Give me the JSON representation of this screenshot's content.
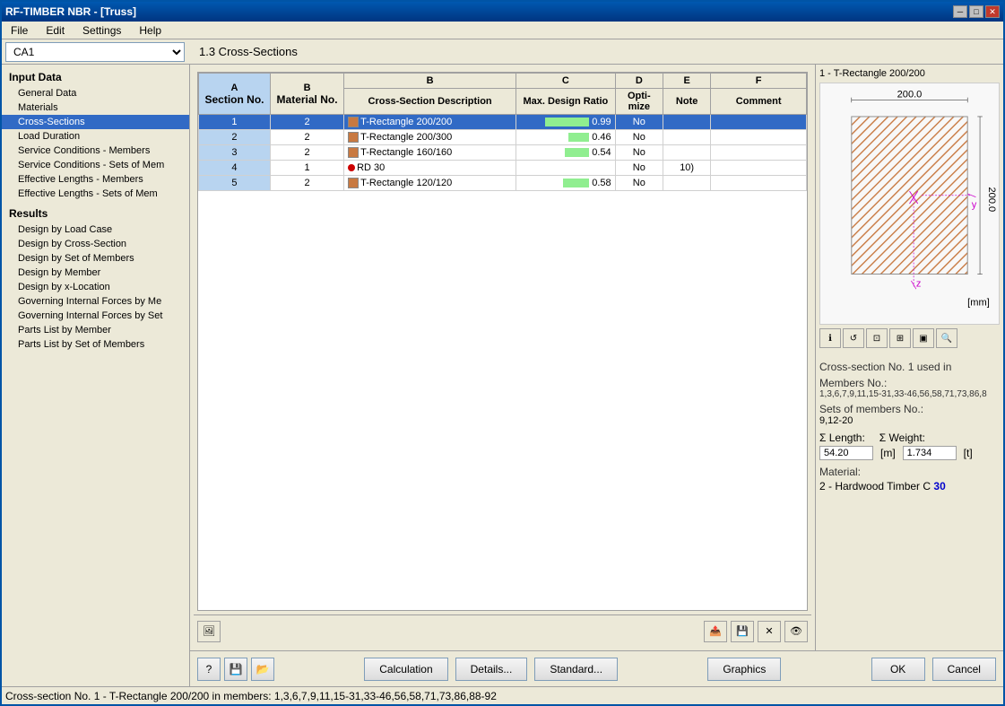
{
  "window": {
    "title": "RF-TIMBER NBR - [Truss]",
    "close_btn": "✕",
    "min_btn": "─",
    "max_btn": "□"
  },
  "menu": {
    "items": [
      "File",
      "Edit",
      "Settings",
      "Help"
    ]
  },
  "toolbar": {
    "ca_value": "CA1"
  },
  "section_title": "1.3 Cross-Sections",
  "sidebar": {
    "input_label": "Input Data",
    "items": [
      {
        "label": "General Data",
        "id": "general-data"
      },
      {
        "label": "Materials",
        "id": "materials"
      },
      {
        "label": "Cross-Sections",
        "id": "cross-sections",
        "selected": true
      },
      {
        "label": "Load Duration",
        "id": "load-duration"
      },
      {
        "label": "Service Conditions - Members",
        "id": "service-conditions-members"
      },
      {
        "label": "Service Conditions - Sets of Mem",
        "id": "service-conditions-sets"
      },
      {
        "label": "Effective Lengths - Members",
        "id": "effective-lengths-members"
      },
      {
        "label": "Effective Lengths - Sets of Mem",
        "id": "effective-lengths-sets"
      }
    ],
    "results_label": "Results",
    "result_items": [
      {
        "label": "Design by Load Case",
        "id": "design-load-case"
      },
      {
        "label": "Design by Cross-Section",
        "id": "design-cross-section"
      },
      {
        "label": "Design by Set of Members",
        "id": "design-set-members"
      },
      {
        "label": "Design by Member",
        "id": "design-member"
      },
      {
        "label": "Design by x-Location",
        "id": "design-x-location"
      },
      {
        "label": "Governing Internal Forces by Me",
        "id": "gov-internal-forces-me"
      },
      {
        "label": "Governing Internal Forces by Set",
        "id": "gov-internal-forces-set"
      },
      {
        "label": "Parts List by Member",
        "id": "parts-list-member"
      },
      {
        "label": "Parts List by Set of Members",
        "id": "parts-list-set"
      }
    ]
  },
  "table": {
    "columns": [
      {
        "label": "A",
        "sub": "Section No.",
        "id": "section-no"
      },
      {
        "label": "B",
        "sub": "Material No.",
        "id": "material-no"
      },
      {
        "label": "B",
        "sub": "Cross-Section Description",
        "id": "cross-section-desc"
      },
      {
        "label": "C",
        "sub": "Max. Design Ratio",
        "id": "max-design-ratio"
      },
      {
        "label": "D",
        "sub": "Opti- mize",
        "id": "optimize"
      },
      {
        "label": "E",
        "sub": "Note",
        "id": "note"
      },
      {
        "label": "F",
        "sub": "Comment",
        "id": "comment"
      }
    ],
    "rows": [
      {
        "section_no": "1",
        "material_no": "2",
        "swatch": "brown",
        "description": "T-Rectangle 200/200",
        "ratio_val": 0.99,
        "ratio_pct": 99,
        "optimize": "No",
        "note": "",
        "comment": "",
        "selected": true
      },
      {
        "section_no": "2",
        "material_no": "2",
        "swatch": "brown",
        "description": "T-Rectangle 200/300",
        "ratio_val": 0.46,
        "ratio_pct": 46,
        "optimize": "No",
        "note": "",
        "comment": ""
      },
      {
        "section_no": "3",
        "material_no": "2",
        "swatch": "brown",
        "description": "T-Rectangle 160/160",
        "ratio_val": 0.54,
        "ratio_pct": 54,
        "optimize": "No",
        "note": "",
        "comment": ""
      },
      {
        "section_no": "4",
        "material_no": "1",
        "swatch": "red-dot",
        "description": "RD 30",
        "ratio_val": null,
        "ratio_pct": 0,
        "optimize": "No",
        "note": "10)",
        "comment": ""
      },
      {
        "section_no": "5",
        "material_no": "2",
        "swatch": "brown",
        "description": "T-Rectangle 120/120",
        "ratio_val": 0.58,
        "ratio_pct": 58,
        "optimize": "No",
        "note": "",
        "comment": ""
      }
    ]
  },
  "preview": {
    "title": "1 - T-Rectangle 200/200",
    "dim_width": "200.0",
    "dim_height": "200.0",
    "unit": "[mm]",
    "used_in_label": "Cross-section No. 1 used in",
    "members_label": "Members No.:",
    "members_value": "1,3,6,7,9,11,15-31,33-46,56,58,71,73,86,8",
    "sets_label": "Sets of members No.:",
    "sets_value": "9,12-20",
    "length_label": "Σ Length:",
    "length_unit": "[m]",
    "length_value": "54.20",
    "weight_label": "Σ Weight:",
    "weight_unit": "[t]",
    "weight_value": "1.734",
    "material_label": "Material:",
    "material_value": "2 - Hardwood Timber C ",
    "material_grade": "30"
  },
  "bottom_buttons": {
    "calculation": "Calculation",
    "details": "Details...",
    "standard": "Standard...",
    "graphics": "Graphics",
    "ok": "OK",
    "cancel": "Cancel"
  },
  "status_bar": {
    "text": "Cross-section No. 1 - T-Rectangle 200/200 in members: 1,3,6,7,9,11,15-31,33-46,56,58,71,73,86,88-92"
  }
}
